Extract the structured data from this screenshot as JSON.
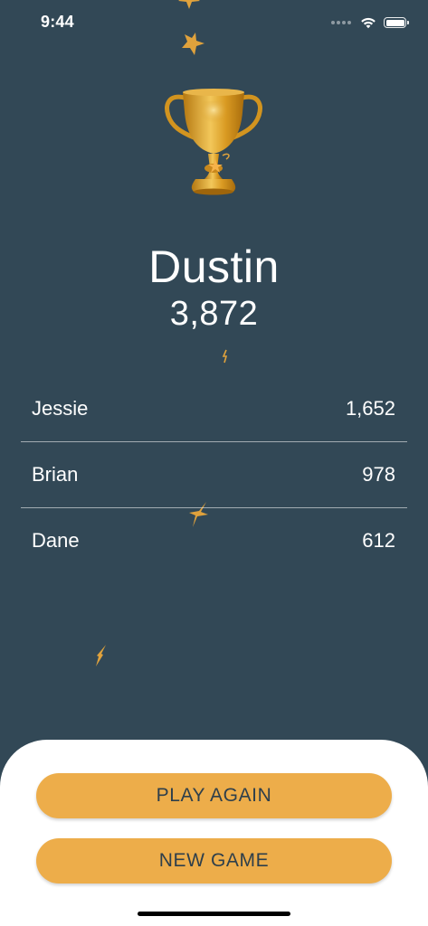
{
  "status_bar": {
    "time": "9:44",
    "icons": [
      "cellular-signal-icon",
      "wifi-icon",
      "battery-icon"
    ]
  },
  "trophy": {
    "icon": "trophy-icon"
  },
  "winner": {
    "name": "Dustin",
    "score": "3,872"
  },
  "standings": [
    {
      "name": "Jessie",
      "score": "1,652"
    },
    {
      "name": "Brian",
      "score": "978"
    },
    {
      "name": "Dane",
      "score": "612"
    }
  ],
  "actions": {
    "play_again_label": "PLAY AGAIN",
    "new_game_label": "NEW GAME"
  },
  "colors": {
    "background": "#324856",
    "accent": "#EDAD4A",
    "sheet": "#FFFFFF",
    "button_text": "#2E3F4B"
  }
}
